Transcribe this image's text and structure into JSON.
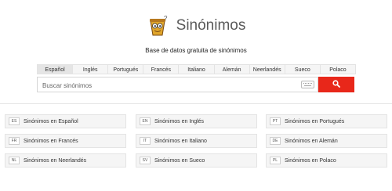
{
  "site": {
    "name": "Sinónimos",
    "tagline": "Base de datos gratuita de sinónimos"
  },
  "tabs": [
    {
      "label": "Español",
      "active": true
    },
    {
      "label": "Inglés",
      "active": false
    },
    {
      "label": "Portugués",
      "active": false
    },
    {
      "label": "Francés",
      "active": false
    },
    {
      "label": "Italiano",
      "active": false
    },
    {
      "label": "Alemán",
      "active": false
    },
    {
      "label": "Neerlandés",
      "active": false
    },
    {
      "label": "Sueco",
      "active": false
    },
    {
      "label": "Polaco",
      "active": false
    }
  ],
  "search": {
    "placeholder": "Buscar sinónimos",
    "button_color": "#e8271a"
  },
  "links": [
    {
      "code": "ES",
      "label": "Sinónimos en Español"
    },
    {
      "code": "EN",
      "label": "Sinónimos en Inglés"
    },
    {
      "code": "PT",
      "label": "Sinónimos en Portugués"
    },
    {
      "code": "FR",
      "label": "Sinónimos en Francés"
    },
    {
      "code": "IT",
      "label": "Sinónimos en Italiano"
    },
    {
      "code": "DE",
      "label": "Sinónimos en Alemán"
    },
    {
      "code": "NL",
      "label": "Sinónimos en Neerlandés"
    },
    {
      "code": "SV",
      "label": "Sinónimos en Sueco"
    },
    {
      "code": "PL",
      "label": "Sinónimos en Polaco"
    }
  ]
}
